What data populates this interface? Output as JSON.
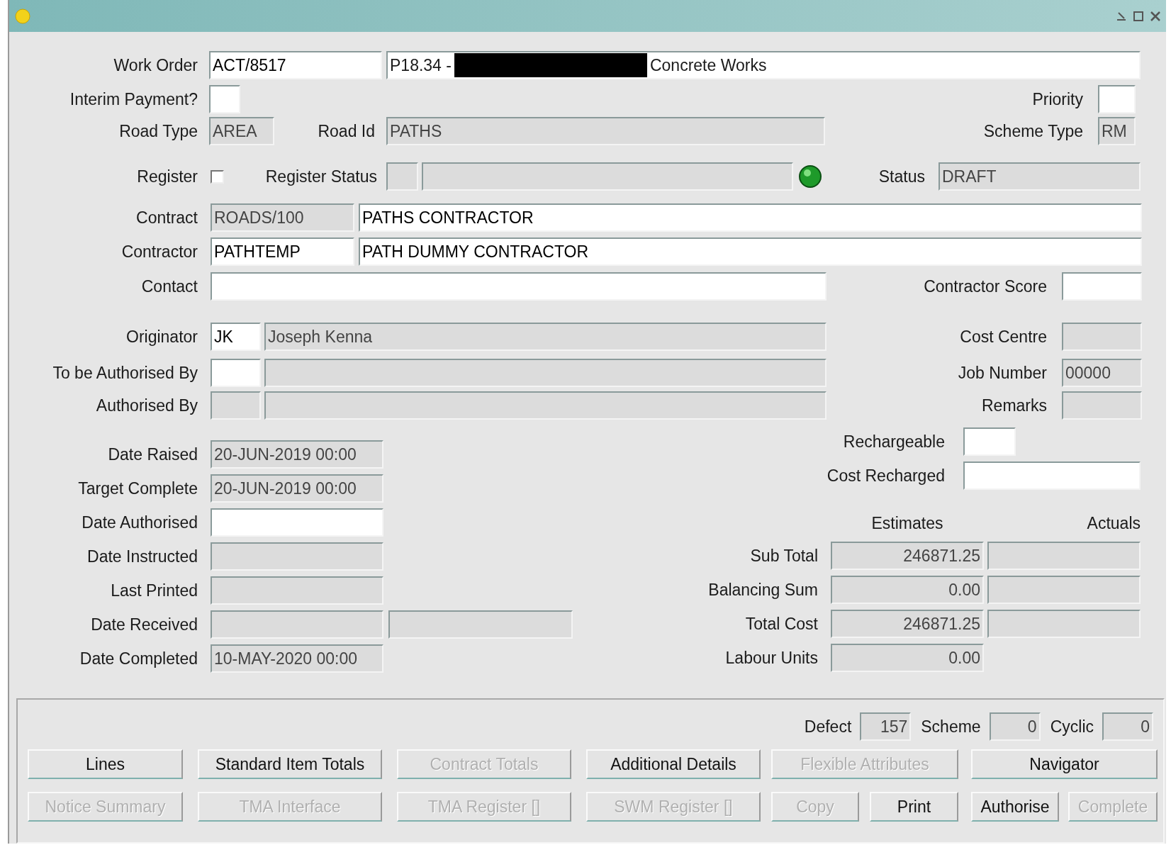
{
  "form": {
    "work_order": {
      "label": "Work Order",
      "code": {
        "value": "ACT/8517",
        "readonly": false
      },
      "description": {
        "prefix": "P18.34 -",
        "redacted": true,
        "suffix": "Concrete Works",
        "readonly": false
      }
    },
    "interim_payment": {
      "label": "Interim Payment?",
      "field": {
        "readonly": false
      }
    },
    "priority": {
      "label": "Priority",
      "field": {
        "readonly": false
      }
    },
    "road_type": {
      "label": "Road Type",
      "field": {
        "value": "AREA",
        "readonly": true
      }
    },
    "road_id": {
      "label": "Road Id",
      "field": {
        "value": "PATHS",
        "readonly": true
      }
    },
    "scheme_type": {
      "label": "Scheme Type",
      "field": {
        "value": "RM",
        "readonly": true
      }
    },
    "register": {
      "label": "Register",
      "checked": false
    },
    "register_status": {
      "label": "Register Status",
      "code": {
        "readonly": true
      },
      "description": {
        "readonly": true
      }
    },
    "status": {
      "label": "Status",
      "field": {
        "value": "DRAFT",
        "readonly": true
      }
    },
    "contract": {
      "label": "Contract",
      "code": {
        "value": "ROADS/100",
        "readonly": true
      },
      "description": {
        "value": "PATHS CONTRACTOR",
        "readonly": false
      }
    },
    "contractor": {
      "label": "Contractor",
      "code": {
        "value": "PATHTEMP",
        "readonly": false
      },
      "description": {
        "value": "PATH DUMMY CONTRACTOR",
        "readonly": false
      }
    },
    "contact": {
      "label": "Contact",
      "field": {
        "readonly": false
      }
    },
    "contractor_score": {
      "label": "Contractor Score",
      "field": {
        "readonly": false
      }
    },
    "originator": {
      "label": "Originator",
      "code": {
        "value": "JK",
        "readonly": false
      },
      "description": {
        "value": "Joseph Kenna",
        "readonly": true
      }
    },
    "cost_centre": {
      "label": "Cost Centre",
      "field": {
        "readonly": true
      }
    },
    "to_be_authorised_by": {
      "label": "To be Authorised By",
      "code": {
        "readonly": false
      },
      "description": {
        "readonly": true
      }
    },
    "job_number": {
      "label": "Job Number",
      "field": {
        "value": "00000",
        "readonly": true
      }
    },
    "authorised_by": {
      "label": "Authorised By",
      "code": {
        "readonly": true
      },
      "description": {
        "readonly": true
      }
    },
    "remarks": {
      "label": "Remarks",
      "field": {
        "readonly": true
      }
    }
  },
  "dates": [
    {
      "label": "Date Raised",
      "field": {
        "value": "20-JUN-2019 00:00",
        "readonly": true
      }
    },
    {
      "label": "Target Complete",
      "field": {
        "value": "20-JUN-2019 00:00",
        "readonly": true
      }
    },
    {
      "label": "Date Authorised",
      "field": {
        "readonly": false
      }
    },
    {
      "label": "Date Instructed",
      "field": {
        "readonly": true
      }
    },
    {
      "label": "Last Printed",
      "field": {
        "readonly": true
      }
    },
    {
      "label": "Date Received",
      "field": {
        "readonly": true
      },
      "extra": {
        "readonly": true
      }
    },
    {
      "label": "Date Completed",
      "field": {
        "value": "10-MAY-2020 00:00",
        "readonly": true
      }
    }
  ],
  "recharge": [
    {
      "label": "Rechargeable",
      "field": {
        "readonly": false
      }
    },
    {
      "label": "Cost Recharged",
      "field": {
        "readonly": false
      }
    }
  ],
  "totals": {
    "columns": [
      "Estimates",
      "Actuals"
    ],
    "rows": [
      {
        "label": "Sub Total",
        "estimate": {
          "value": "246871.25",
          "readonly": true
        },
        "actual": {
          "readonly": true
        }
      },
      {
        "label": "Balancing Sum",
        "estimate": {
          "value": "0.00",
          "readonly": true
        },
        "actual": {
          "readonly": true
        }
      },
      {
        "label": "Total Cost",
        "estimate": {
          "value": "246871.25",
          "readonly": true
        },
        "actual": {
          "readonly": true
        }
      },
      {
        "label": "Labour Units",
        "estimate": {
          "value": "0.00",
          "readonly": true
        }
      }
    ]
  },
  "counts": [
    {
      "label": "Defect",
      "field": {
        "value": "157",
        "readonly": true
      }
    },
    {
      "label": "Scheme",
      "field": {
        "value": "0",
        "readonly": true
      }
    },
    {
      "label": "Cyclic",
      "field": {
        "value": "0",
        "readonly": true
      }
    }
  ],
  "button_rows": [
    [
      {
        "label": "Lines",
        "disabled": false
      },
      {
        "label": "Standard Item Totals",
        "disabled": false
      },
      {
        "label": "Contract Totals",
        "disabled": true
      },
      {
        "label": "Additional Details",
        "disabled": false
      },
      {
        "label": "Flexible Attributes",
        "disabled": true
      },
      {
        "label": "Navigator",
        "disabled": false
      }
    ],
    [
      {
        "label": "Notice Summary",
        "disabled": true
      },
      {
        "label": "TMA Interface",
        "disabled": true
      },
      {
        "label": "TMA Register []",
        "disabled": true
      },
      {
        "label": "SWM Register []",
        "disabled": true
      },
      {
        "label": "Copy",
        "disabled": true
      },
      {
        "label": "Print",
        "disabled": false
      },
      {
        "label": "Authorise",
        "disabled": false
      },
      {
        "label": "Complete",
        "disabled": true
      }
    ]
  ]
}
